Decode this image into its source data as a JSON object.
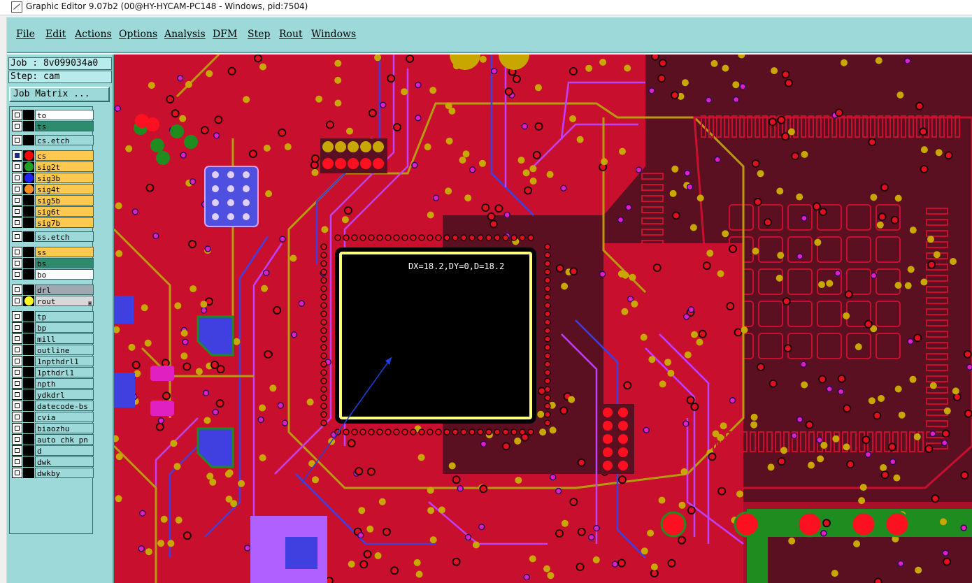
{
  "window": {
    "title": "Graphic Editor 9.07b2 (00@HY-HYCAM-PC148 - Windows, pid:7504)"
  },
  "menu": [
    "File",
    "Edit",
    "Actions",
    "Options",
    "Analysis",
    "DFM",
    "Step",
    "Rout",
    "Windows"
  ],
  "job": {
    "job_label": "Job : 8v099034a0",
    "step_label": "Step: cam",
    "matrix_button": "Job Matrix ..."
  },
  "layers": [
    {
      "name": "to",
      "bg": "#ffffff",
      "dot": null,
      "checked": false
    },
    {
      "name": "ts",
      "bg": "#2e8b6e",
      "dot": null,
      "checked": false
    },
    {
      "name": "cs.etch",
      "bg": "#9dd9d9",
      "dot": null,
      "checked": false
    },
    {
      "name": "cs",
      "bg": "#ffc850",
      "dot": "#ff0000",
      "checked": true
    },
    {
      "name": "sig2t",
      "bg": "#ffc850",
      "dot": "#20a020",
      "checked": false
    },
    {
      "name": "sig3b",
      "bg": "#ffc850",
      "dot": "#2020ff",
      "checked": false
    },
    {
      "name": "sig4t",
      "bg": "#ffc850",
      "dot": "#ff8c20",
      "checked": false
    },
    {
      "name": "sig5b",
      "bg": "#ffc850",
      "dot": null,
      "checked": false
    },
    {
      "name": "sig6t",
      "bg": "#ffc850",
      "dot": null,
      "checked": false
    },
    {
      "name": "sig7b",
      "bg": "#ffc850",
      "dot": null,
      "checked": false
    },
    {
      "name": "ss.etch",
      "bg": "#9dd9d9",
      "dot": null,
      "checked": false
    },
    {
      "name": "ss",
      "bg": "#ffc850",
      "dot": null,
      "checked": false
    },
    {
      "name": "bs",
      "bg": "#2e8b6e",
      "dot": null,
      "checked": false
    },
    {
      "name": "bo",
      "bg": "#ffffff",
      "dot": null,
      "checked": false
    },
    {
      "name": "drl",
      "bg": "#a0a8b0",
      "dot": null,
      "checked": false
    },
    {
      "name": "rout",
      "bg": "#d8d8d8",
      "dot": "#ffff20",
      "checked": false,
      "mark": "▣"
    },
    {
      "name": "tp",
      "bg": "#9dd9d9",
      "dot": null,
      "checked": false
    },
    {
      "name": "bp",
      "bg": "#9dd9d9",
      "dot": null,
      "checked": false
    },
    {
      "name": "mill",
      "bg": "#9dd9d9",
      "dot": null,
      "checked": false
    },
    {
      "name": "outline",
      "bg": "#9dd9d9",
      "dot": null,
      "checked": false
    },
    {
      "name": "1npthdrl1",
      "bg": "#9dd9d9",
      "dot": null,
      "checked": false
    },
    {
      "name": "1pthdrl1",
      "bg": "#9dd9d9",
      "dot": null,
      "checked": false
    },
    {
      "name": "npth",
      "bg": "#9dd9d9",
      "dot": null,
      "checked": false
    },
    {
      "name": "ydkdrl",
      "bg": "#9dd9d9",
      "dot": null,
      "checked": false
    },
    {
      "name": "datecode-bs",
      "bg": "#9dd9d9",
      "dot": null,
      "checked": false
    },
    {
      "name": "cvia",
      "bg": "#9dd9d9",
      "dot": null,
      "checked": false
    },
    {
      "name": "biaozhu",
      "bg": "#9dd9d9",
      "dot": null,
      "checked": false
    },
    {
      "name": "auto_chk_pn",
      "bg": "#9dd9d9",
      "dot": null,
      "checked": false
    },
    {
      "name": "d",
      "bg": "#9dd9d9",
      "dot": null,
      "checked": false
    },
    {
      "name": "dwk",
      "bg": "#9dd9d9",
      "dot": null,
      "checked": false
    },
    {
      "name": "dwkby",
      "bg": "#9dd9d9",
      "dot": null,
      "checked": false
    }
  ],
  "canvas": {
    "measure_text": "DX=18.2,DY=0,D=18.2"
  },
  "colors": {
    "board": "#c8102e",
    "dark_copper": "#5a1020",
    "pad": "#c8a800",
    "trace_purple": "#c040ff",
    "trace_blue": "#4040e0",
    "outline_yellow": "#b89a10",
    "highlight_pink": "#e020c0"
  }
}
